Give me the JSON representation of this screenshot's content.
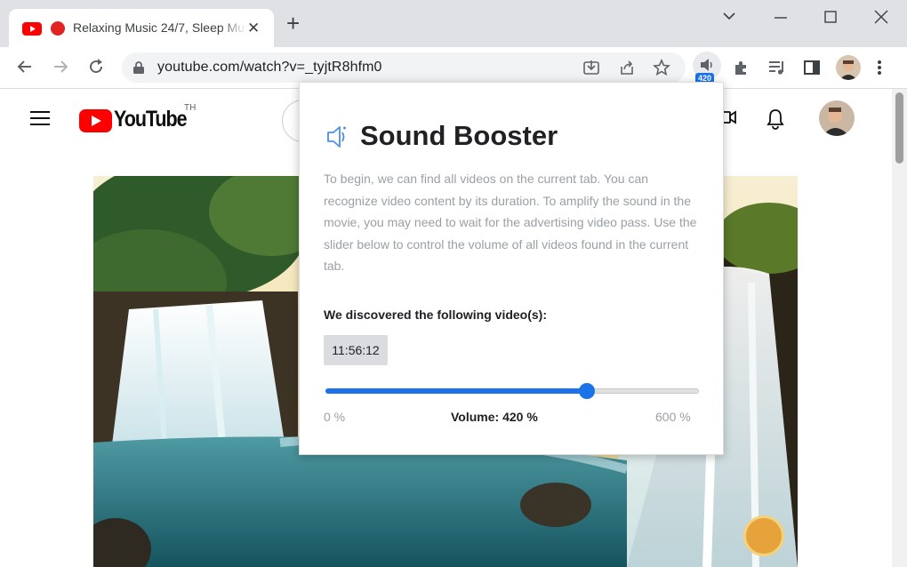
{
  "tab": {
    "title": "Relaxing Music 24/7, Sleep Music",
    "close_icon": "close-icon",
    "audio_indicator_color": "#e02424"
  },
  "window_controls": [
    "chevron-down-icon",
    "minimize-icon",
    "maximize-icon",
    "close-icon"
  ],
  "toolbar": {
    "url": "youtube.com/watch?v=_tyjtR8hfm0",
    "extension_badge": "420"
  },
  "youtube": {
    "logo_text": "YouTube",
    "country_code": "TH",
    "brand_color": "#ff0000"
  },
  "popup": {
    "title": "Sound Booster",
    "description": "To begin, we can find all videos on the current tab. You can recognize video content by its duration. To amplify the sound in the movie, you may need to wait for the advertising video pass. Use the slider below to control the volume of all videos found in the current tab.",
    "found_label": "We discovered the following video(s):",
    "videos": [
      "11:56:12"
    ],
    "volume": {
      "min_label": "0 %",
      "max_label": "600 %",
      "label": "Volume: 420 %",
      "value_percent": 420,
      "max_percent": 600
    },
    "accent_color": "#1a73e8"
  }
}
